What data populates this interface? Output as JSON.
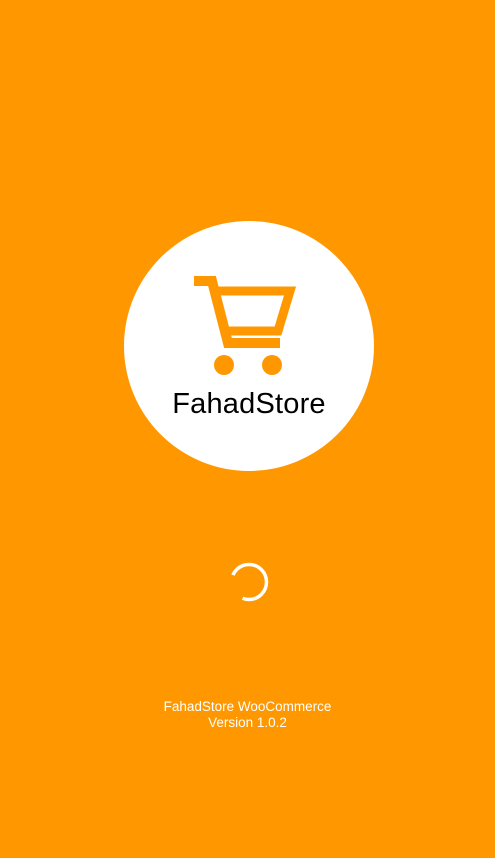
{
  "colors": {
    "background": "#FF9800",
    "logo_circle": "#FFFFFF",
    "cart_icon": "#FF9800",
    "brand_text": "#000000",
    "footer_text": "#FFFFFF"
  },
  "logo": {
    "icon": "shopping-cart-icon",
    "brand_name": "FahadStore"
  },
  "loading": {
    "icon": "loading-spinner-icon"
  },
  "footer": {
    "app_name": "FahadStore WooCommerce",
    "version": "Version 1.0.2"
  }
}
